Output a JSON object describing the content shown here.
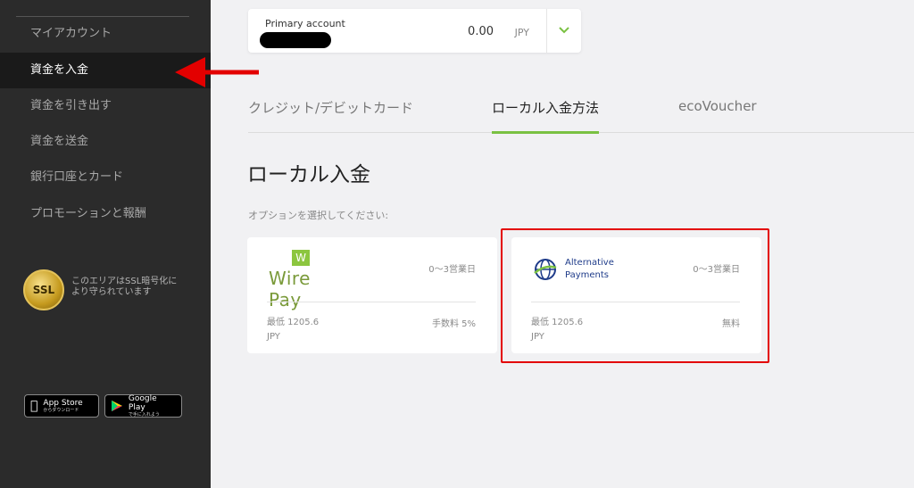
{
  "sidebar": {
    "items": [
      {
        "label": "マイアカウント",
        "active": false
      },
      {
        "label": "資金を入金",
        "active": true
      },
      {
        "label": "資金を引き出す",
        "active": false
      },
      {
        "label": "資金を送金",
        "active": false
      },
      {
        "label": "銀行口座とカード",
        "active": false
      },
      {
        "label": "プロモーションと報酬",
        "active": false
      }
    ],
    "ssl_badge": "SSL",
    "ssl_text": "このエリアはSSL暗号化により守られています",
    "app_store": {
      "title": "App Store",
      "subtitle": "からダウンロード"
    },
    "google_play": {
      "title": "Google Play",
      "subtitle": "で手に入れよう"
    }
  },
  "account": {
    "label": "Primary account",
    "balance": "0.00",
    "currency": "JPY"
  },
  "tabs": [
    {
      "label": "クレジット/デビットカード",
      "active": false
    },
    {
      "label": "ローカル入金方法",
      "active": true
    },
    {
      "label": "ecoVoucher",
      "active": false
    }
  ],
  "section_title": "ローカル入金",
  "prompt": "オプションを選択してください:",
  "methods": [
    {
      "name": "Wire Pay",
      "logo_mark": "W",
      "days": "0〜3営業日",
      "min_line1": "最低 1205.6",
      "min_line2": "JPY",
      "fee": "手数料 5%"
    },
    {
      "name_line1": "Alternative",
      "name_line2": "Payments",
      "days": "0〜3営業日",
      "min_line1": "最低 1205.6",
      "min_line2": "JPY",
      "fee": "無料"
    }
  ],
  "colors": {
    "accent": "#7ac142",
    "sidebar_bg": "#2b2b2b",
    "highlight": "#e30000"
  }
}
